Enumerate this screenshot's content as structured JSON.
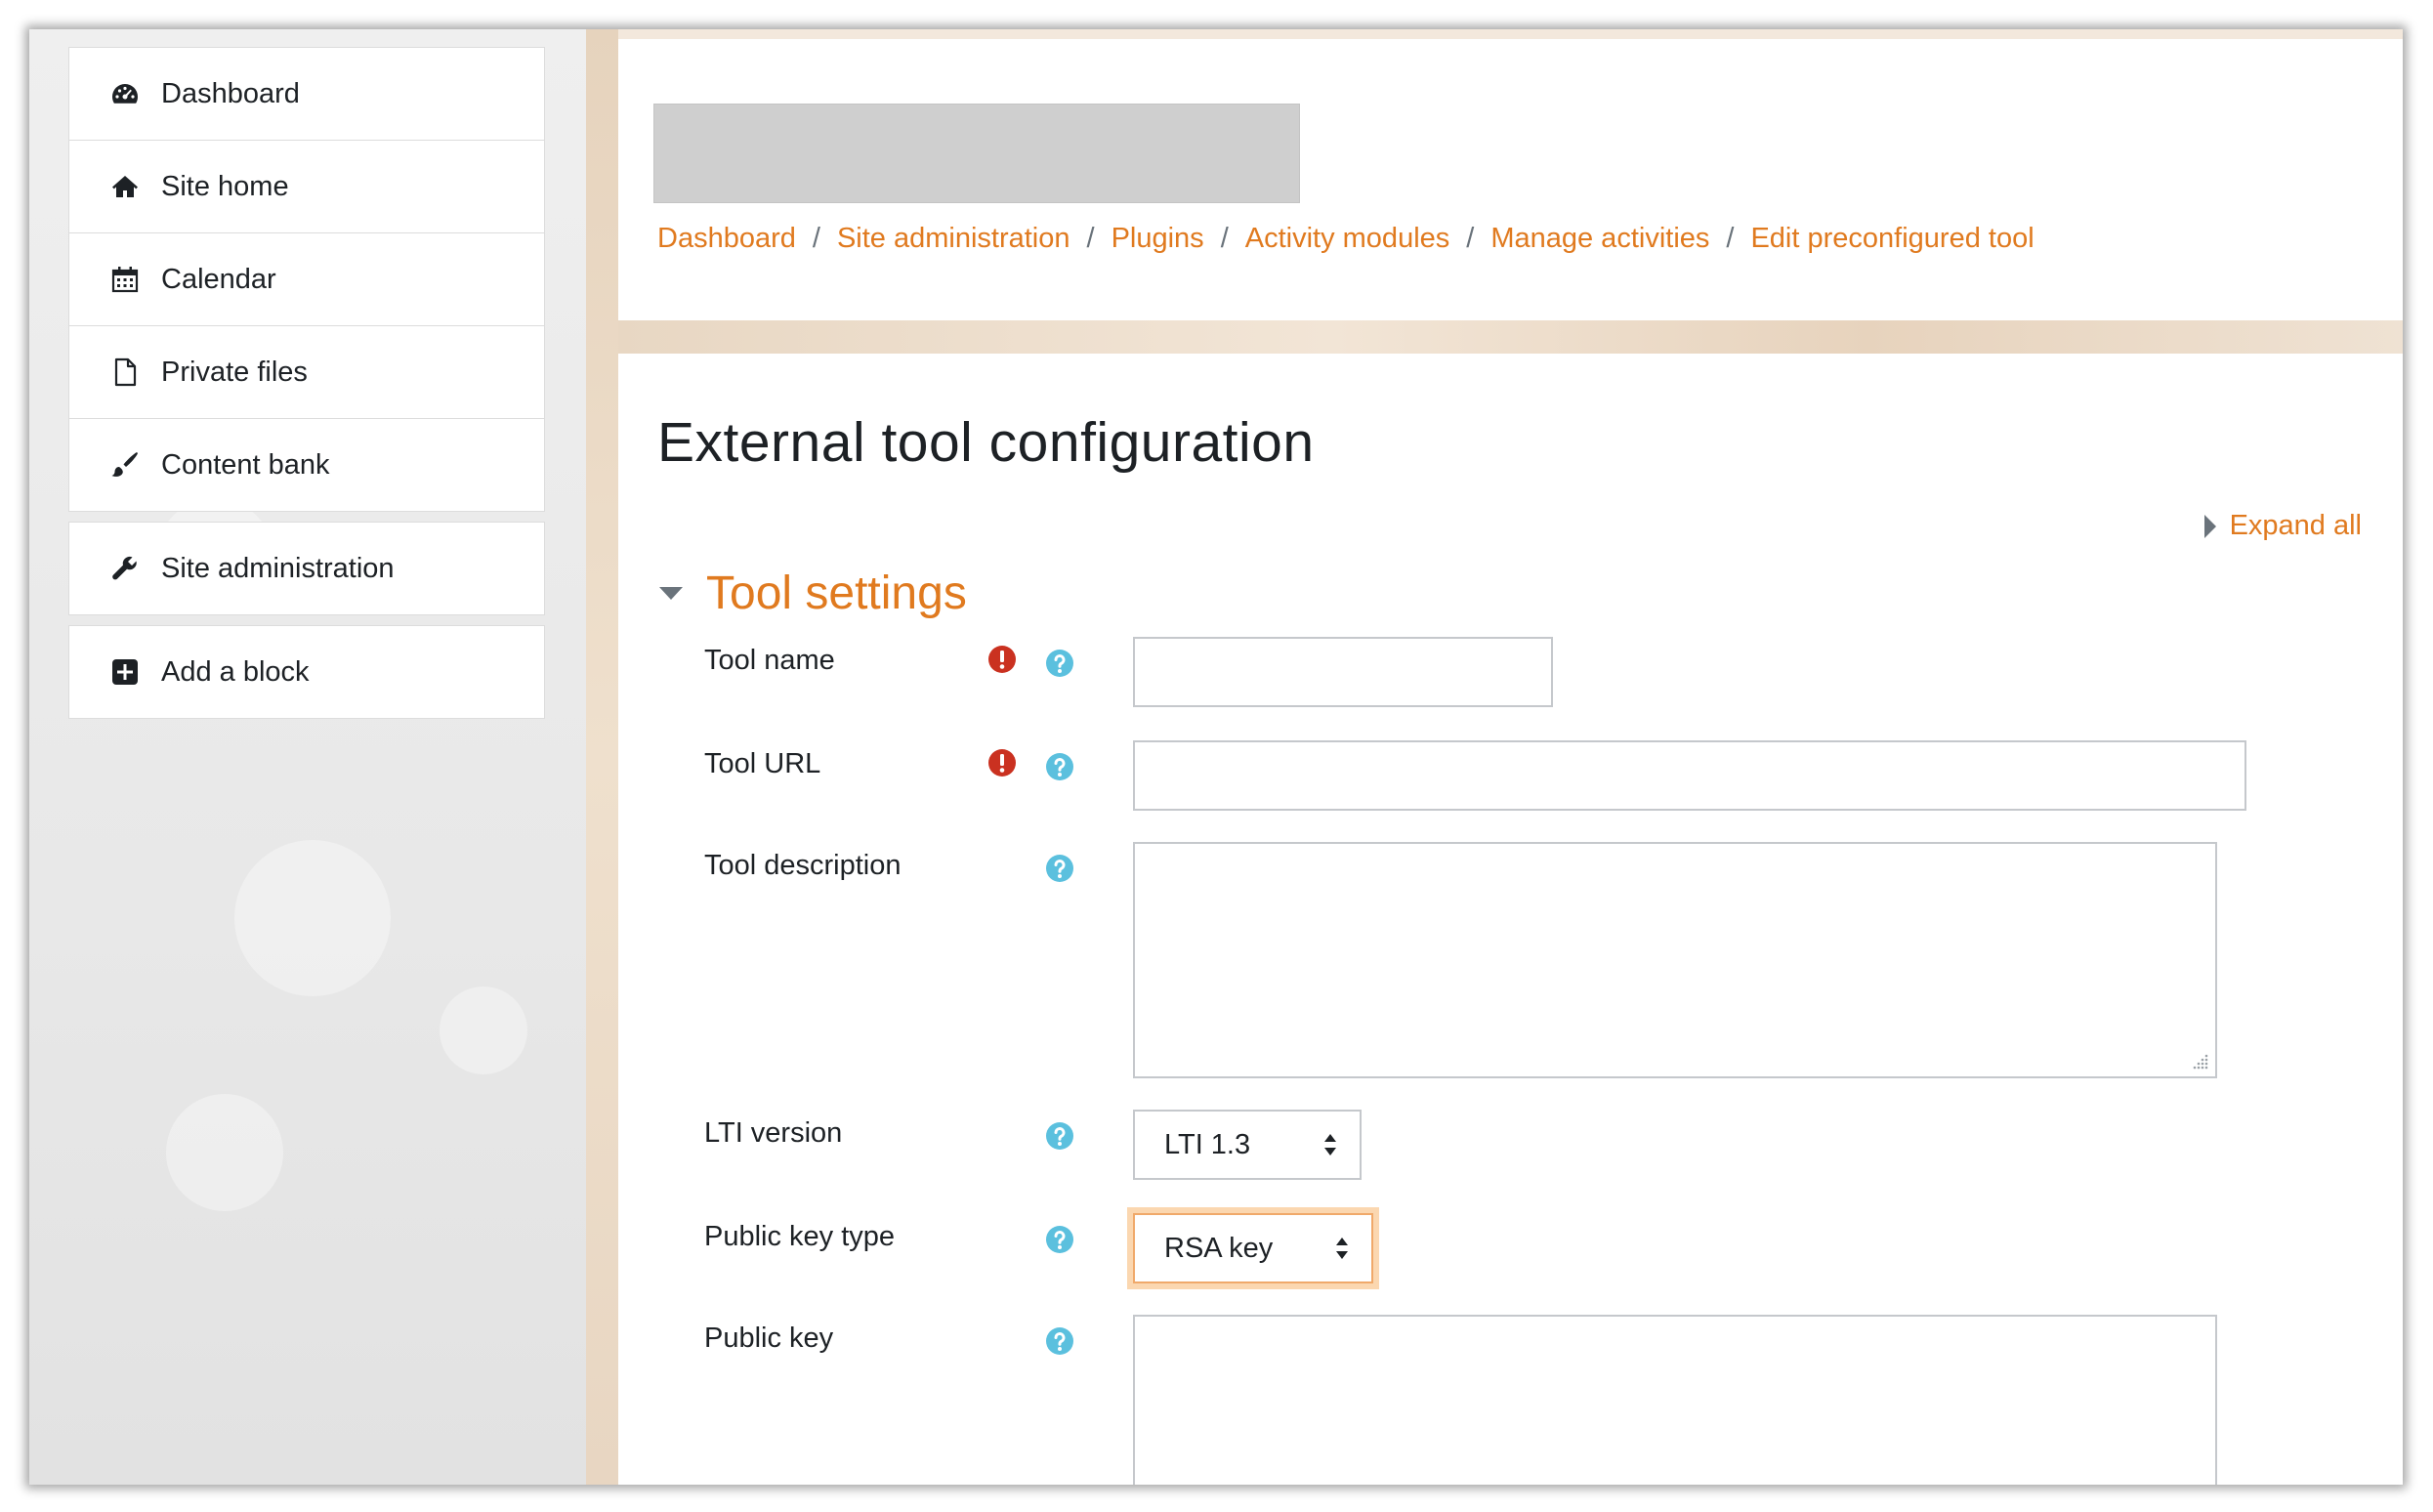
{
  "sidebar": {
    "block1": [
      {
        "label": "Dashboard",
        "icon": "dashboard-icon"
      },
      {
        "label": "Site home",
        "icon": "home-icon"
      },
      {
        "label": "Calendar",
        "icon": "calendar-icon"
      },
      {
        "label": "Private files",
        "icon": "file-icon"
      },
      {
        "label": "Content bank",
        "icon": "paintbrush-icon"
      }
    ],
    "site_admin": {
      "label": "Site administration",
      "icon": "wrench-icon"
    },
    "add_block": {
      "label": "Add a block",
      "icon": "plus-square-icon"
    }
  },
  "breadcrumb": [
    "Dashboard",
    "Site administration",
    "Plugins",
    "Activity modules",
    "Manage activities",
    "Edit preconfigured tool"
  ],
  "breadcrumb_separator": "/",
  "page": {
    "title": "External tool configuration",
    "expand_all": "Expand all"
  },
  "section": {
    "title": "Tool settings",
    "fields": {
      "tool_name": {
        "label": "Tool name",
        "required": true,
        "value": ""
      },
      "tool_url": {
        "label": "Tool URL",
        "required": true,
        "value": ""
      },
      "tool_description": {
        "label": "Tool description",
        "value": ""
      },
      "lti_version": {
        "label": "LTI version",
        "selected": "LTI 1.3"
      },
      "public_key_type": {
        "label": "Public key type",
        "selected": "RSA key"
      },
      "public_key": {
        "label": "Public key",
        "value": ""
      }
    }
  },
  "colors": {
    "accent": "#e07a1f",
    "required": "#ca3120",
    "help": "#5bc0de"
  }
}
